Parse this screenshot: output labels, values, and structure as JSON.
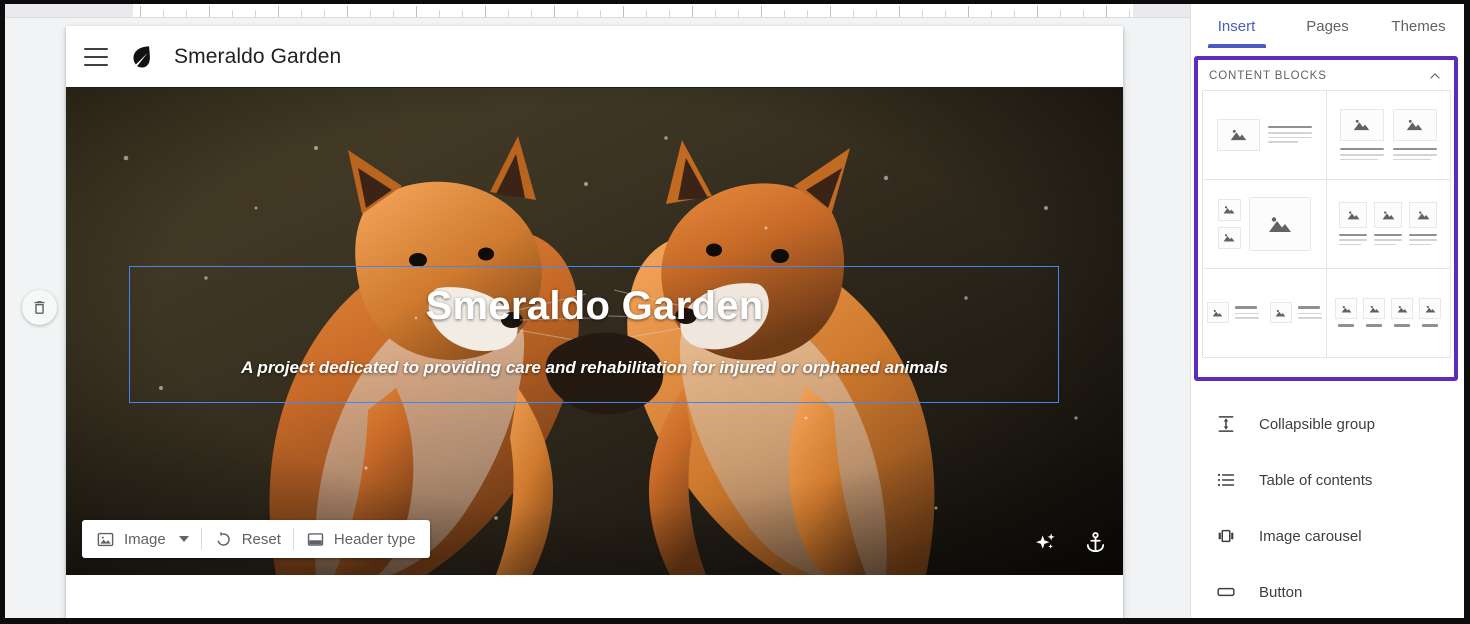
{
  "site": {
    "title": "Smeraldo Garden",
    "menu_icon": "hamburger-icon",
    "logo_icon": "leaf-logo-icon"
  },
  "hero": {
    "title": "Smeraldo Garden",
    "subtitle": "A project dedicated to providing care and rehabilitation for injured or orphaned animals",
    "toolbar": {
      "image_label": "Image",
      "reset_label": "Reset",
      "header_type_label": "Header type",
      "image_icon": "image-icon",
      "reset_icon": "reset-undo-icon",
      "header_type_icon": "header-layout-icon"
    },
    "corner_icons": {
      "sparkle": "sparkle-icon",
      "anchor": "anchor-icon"
    },
    "delete_icon": "trash-icon"
  },
  "panel": {
    "tabs": [
      {
        "label": "Insert",
        "active": true
      },
      {
        "label": "Pages",
        "active": false
      },
      {
        "label": "Themes",
        "active": false
      }
    ],
    "content_blocks": {
      "section_label": "CONTENT BLOCKS",
      "collapse_icon": "chevron-up-icon",
      "highlight_color": "#5c2dbd",
      "items": [
        {
          "name": "image-left-text-right"
        },
        {
          "name": "two-images-with-text"
        },
        {
          "name": "two-small-one-large-image"
        },
        {
          "name": "three-images-with-text"
        },
        {
          "name": "two-image-text-pairs"
        },
        {
          "name": "four-images-with-captions"
        }
      ]
    },
    "list_items": [
      {
        "label": "Collapsible group",
        "icon": "collapsible-group-icon"
      },
      {
        "label": "Table of contents",
        "icon": "table-of-contents-icon"
      },
      {
        "label": "Image carousel",
        "icon": "image-carousel-icon"
      },
      {
        "label": "Button",
        "icon": "button-icon"
      }
    ]
  },
  "colors": {
    "accent_purple": "#5c2dbd",
    "tab_active": "#4a5bc4",
    "selection_blue": "#4285f4"
  }
}
